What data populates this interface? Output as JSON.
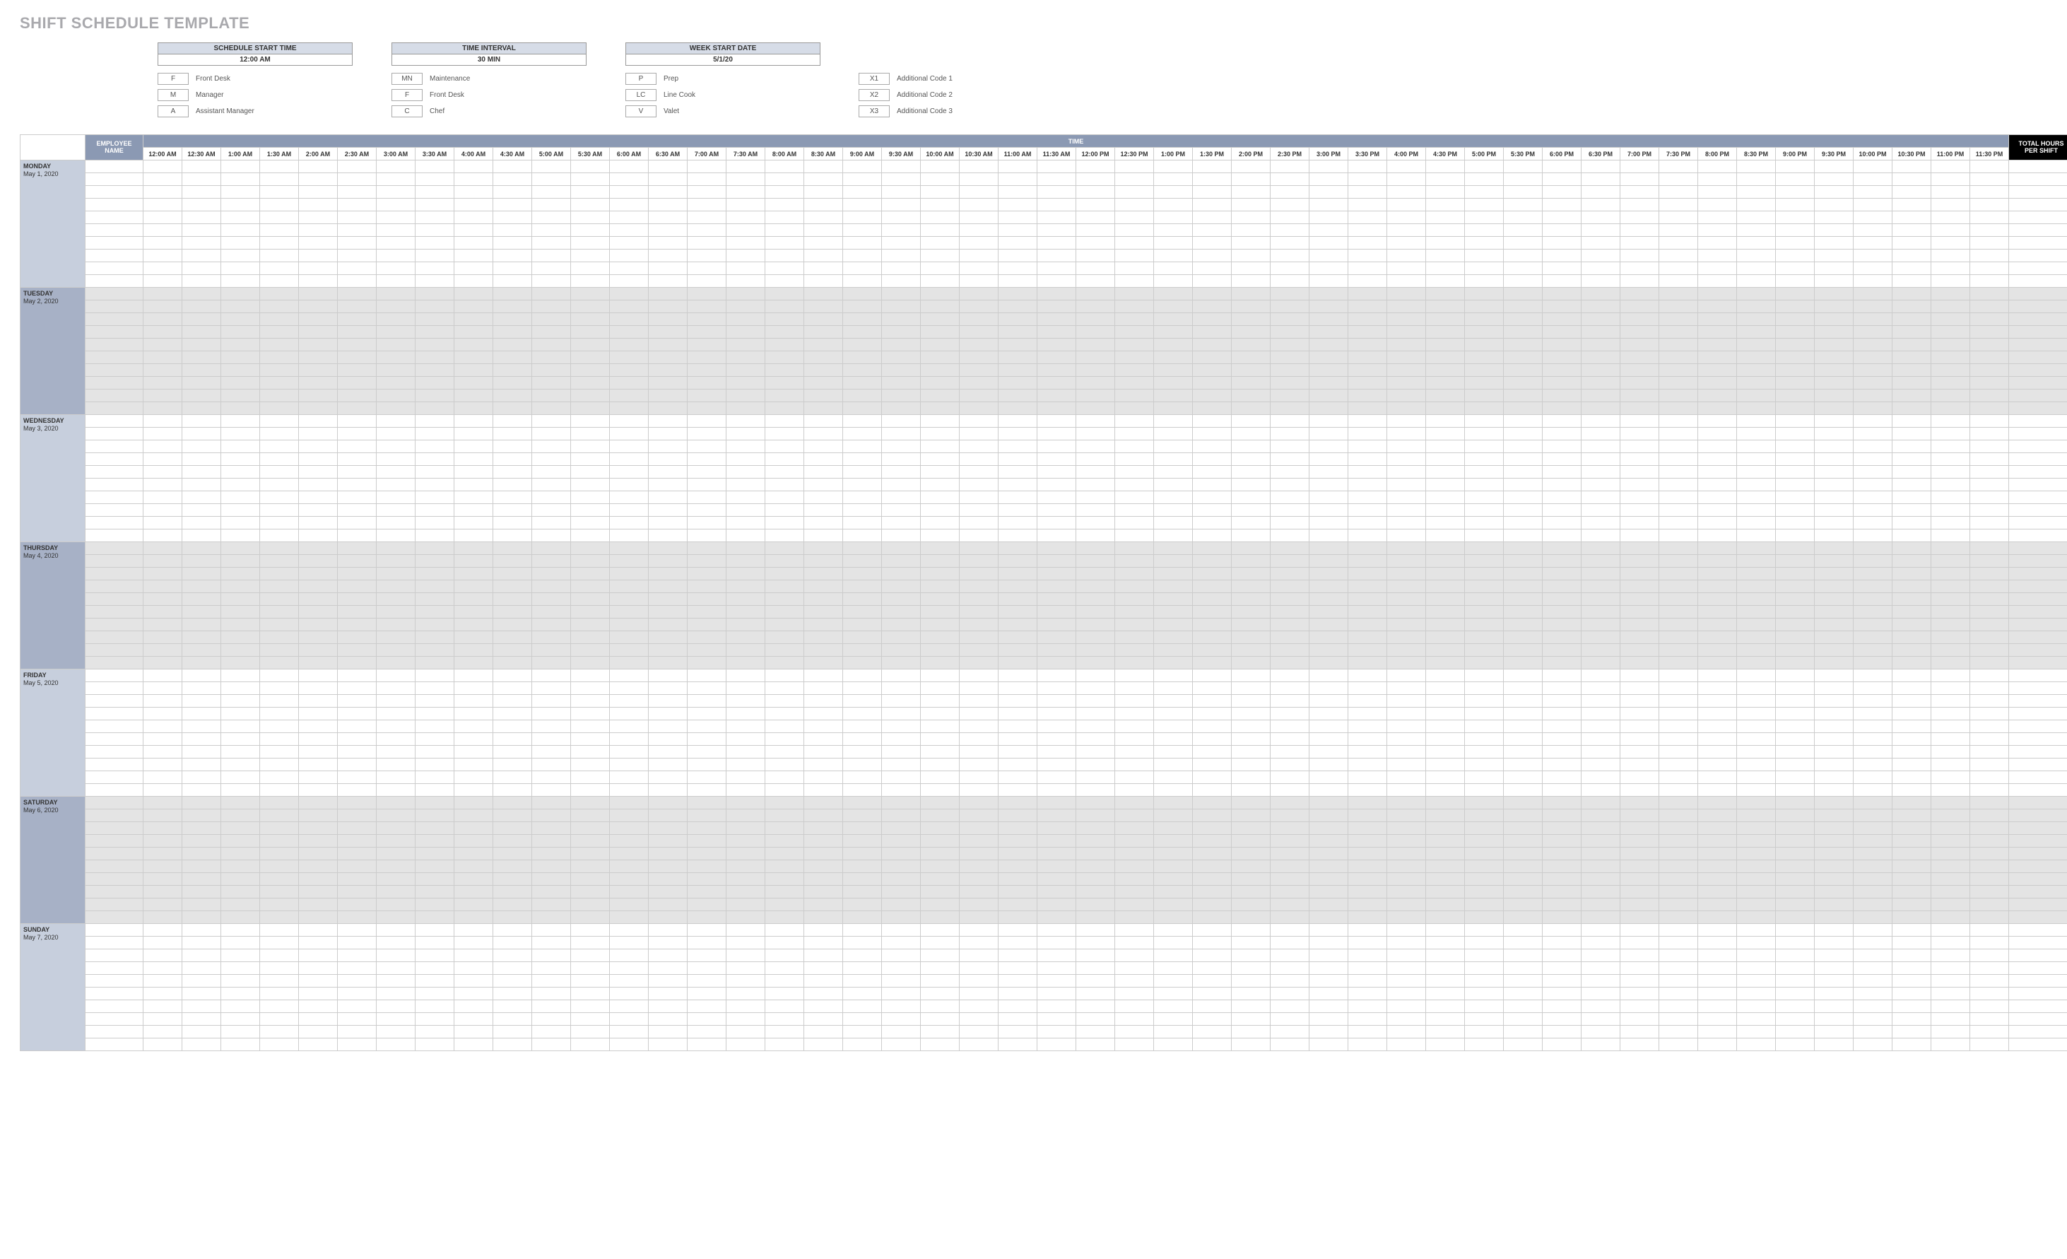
{
  "title": "SHIFT SCHEDULE TEMPLATE",
  "settings": [
    {
      "label": "SCHEDULE START TIME",
      "value": "12:00 AM"
    },
    {
      "label": "TIME INTERVAL",
      "value": "30 MIN"
    },
    {
      "label": "WEEK START DATE",
      "value": "5/1/20"
    }
  ],
  "legend_cols": [
    [
      {
        "code": "F",
        "label": "Front Desk"
      },
      {
        "code": "M",
        "label": "Manager"
      },
      {
        "code": "A",
        "label": "Assistant Manager"
      }
    ],
    [
      {
        "code": "MN",
        "label": "Maintenance"
      },
      {
        "code": "F",
        "label": "Front Desk"
      },
      {
        "code": "C",
        "label": "Chef"
      }
    ],
    [
      {
        "code": "P",
        "label": "Prep"
      },
      {
        "code": "LC",
        "label": "Line Cook"
      },
      {
        "code": "V",
        "label": "Valet"
      }
    ]
  ],
  "legend_extra": [
    {
      "code": "X1",
      "label": "Additional Code 1"
    },
    {
      "code": "X2",
      "label": "Additional Code 2"
    },
    {
      "code": "X3",
      "label": "Additional Code 3"
    }
  ],
  "headers": {
    "employee": "EMPLOYEE NAME",
    "time": "TIME",
    "total": "TOTAL HOURS PER SHIFT"
  },
  "time_slots": [
    "12:00 AM",
    "12:30 AM",
    "1:00 AM",
    "1:30 AM",
    "2:00 AM",
    "2:30 AM",
    "3:00 AM",
    "3:30 AM",
    "4:00 AM",
    "4:30 AM",
    "5:00 AM",
    "5:30 AM",
    "6:00 AM",
    "6:30 AM",
    "7:00 AM",
    "7:30 AM",
    "8:00 AM",
    "8:30 AM",
    "9:00 AM",
    "9:30 AM",
    "10:00 AM",
    "10:30 AM",
    "11:00 AM",
    "11:30 AM",
    "12:00 PM",
    "12:30 PM",
    "1:00 PM",
    "1:30 PM",
    "2:00 PM",
    "2:30 PM",
    "3:00 PM",
    "3:30 PM",
    "4:00 PM",
    "4:30 PM",
    "5:00 PM",
    "5:30 PM",
    "6:00 PM",
    "6:30 PM",
    "7:00 PM",
    "7:30 PM",
    "8:00 PM",
    "8:30 PM",
    "9:00 PM",
    "9:30 PM",
    "10:00 PM",
    "10:30 PM",
    "11:00 PM",
    "11:30 PM"
  ],
  "days": [
    {
      "name": "MONDAY",
      "date": "May 1, 2020",
      "shaded": false
    },
    {
      "name": "TUESDAY",
      "date": "May 2, 2020",
      "shaded": true
    },
    {
      "name": "WEDNESDAY",
      "date": "May 3, 2020",
      "shaded": false
    },
    {
      "name": "THURSDAY",
      "date": "May 4, 2020",
      "shaded": true
    },
    {
      "name": "FRIDAY",
      "date": "May 5, 2020",
      "shaded": false
    },
    {
      "name": "SATURDAY",
      "date": "May 6, 2020",
      "shaded": true
    },
    {
      "name": "SUNDAY",
      "date": "May 7, 2020",
      "shaded": false
    }
  ],
  "rows_per_day": 10
}
